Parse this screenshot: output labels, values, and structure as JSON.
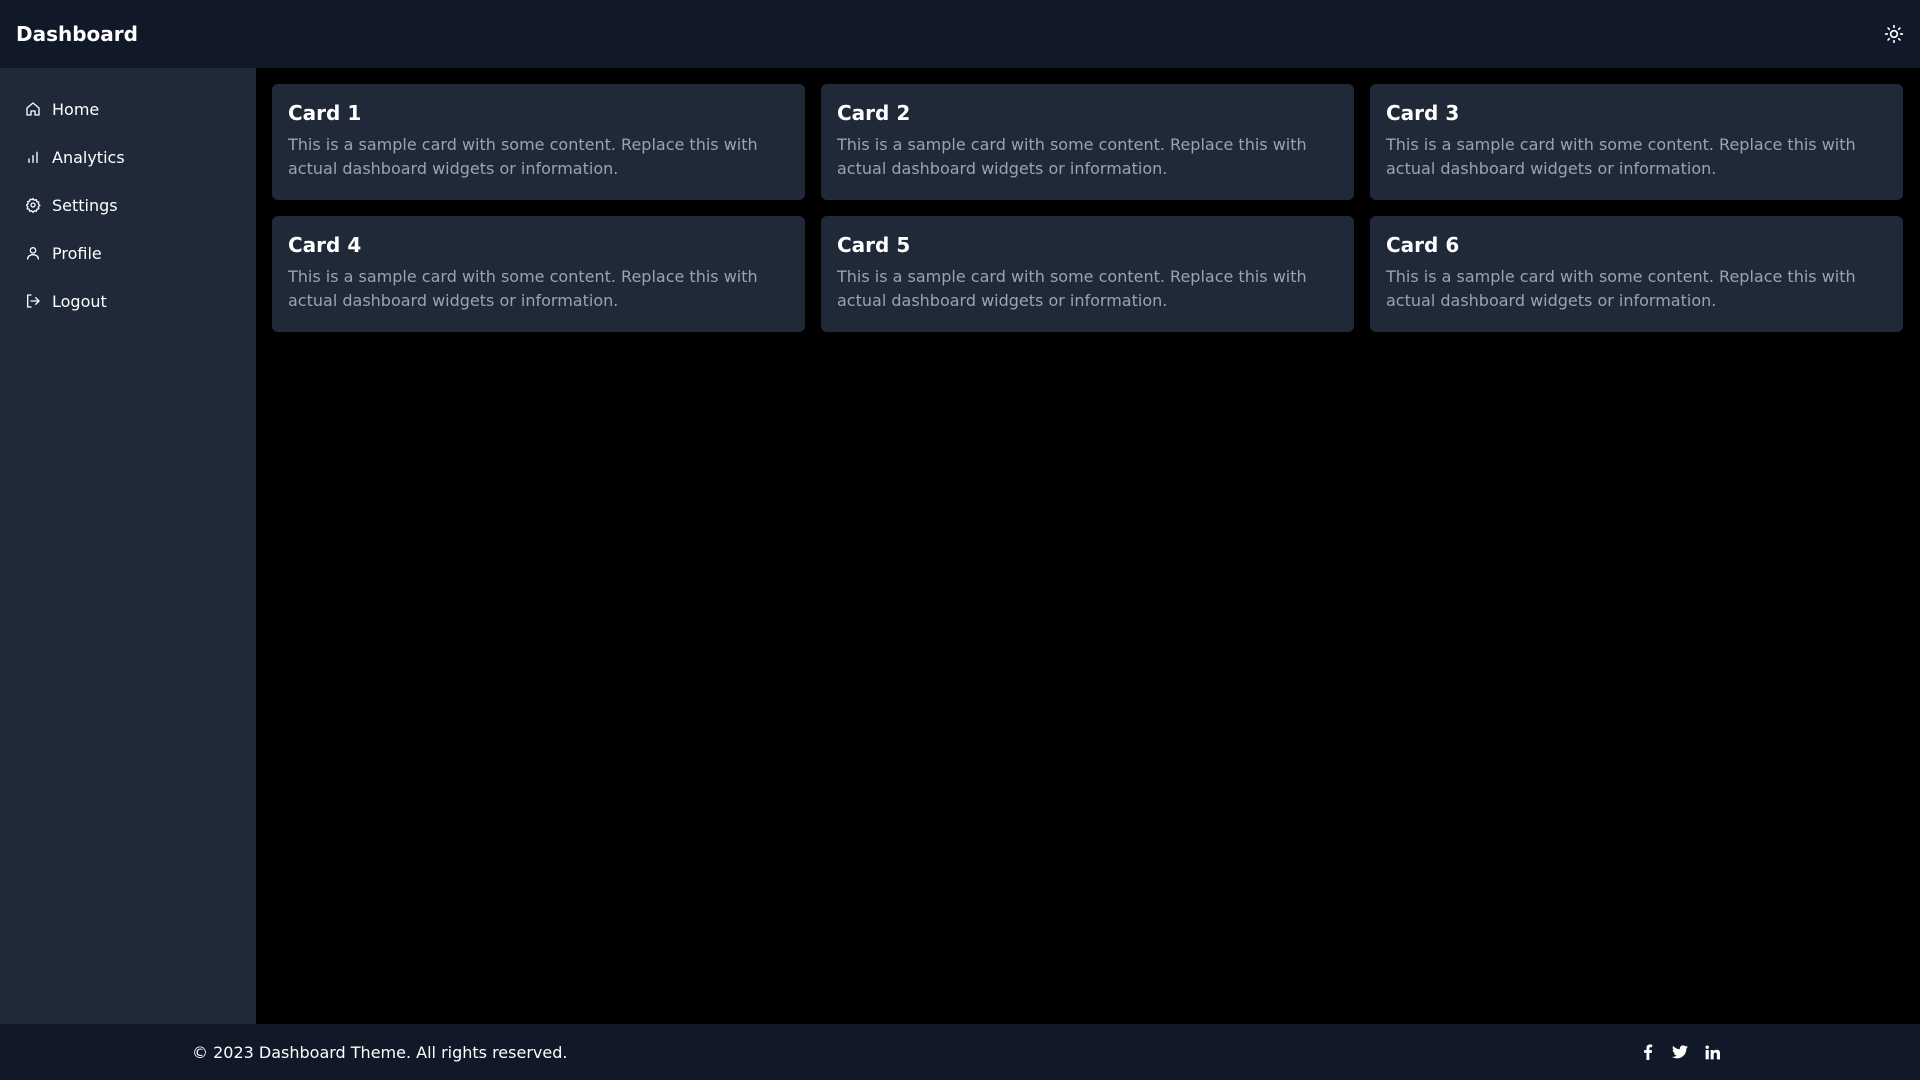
{
  "header": {
    "title": "Dashboard",
    "theme_toggle_icon": "sun-icon"
  },
  "sidebar": {
    "items": [
      {
        "label": "Home",
        "icon": "home-icon"
      },
      {
        "label": "Analytics",
        "icon": "bar-chart-icon"
      },
      {
        "label": "Settings",
        "icon": "gear-icon"
      },
      {
        "label": "Profile",
        "icon": "user-icon"
      },
      {
        "label": "Logout",
        "icon": "logout-icon"
      }
    ]
  },
  "cards": [
    {
      "title": "Card 1",
      "body": "This is a sample card with some content. Replace this with actual dashboard widgets or information."
    },
    {
      "title": "Card 2",
      "body": "This is a sample card with some content. Replace this with actual dashboard widgets or information."
    },
    {
      "title": "Card 3",
      "body": "This is a sample card with some content. Replace this with actual dashboard widgets or information."
    },
    {
      "title": "Card 4",
      "body": "This is a sample card with some content. Replace this with actual dashboard widgets or information."
    },
    {
      "title": "Card 5",
      "body": "This is a sample card with some content. Replace this with actual dashboard widgets or information."
    },
    {
      "title": "Card 6",
      "body": "This is a sample card with some content. Replace this with actual dashboard widgets or information."
    }
  ],
  "footer": {
    "copyright": "© 2023 Dashboard Theme. All rights reserved.",
    "socials": [
      "facebook-icon",
      "twitter-icon",
      "linkedin-icon"
    ]
  },
  "colors": {
    "header_bg": "#111827",
    "sidebar_bg": "#1f2937",
    "card_bg": "#1f2937",
    "main_bg": "#000000",
    "muted_text": "#9ca3af"
  }
}
